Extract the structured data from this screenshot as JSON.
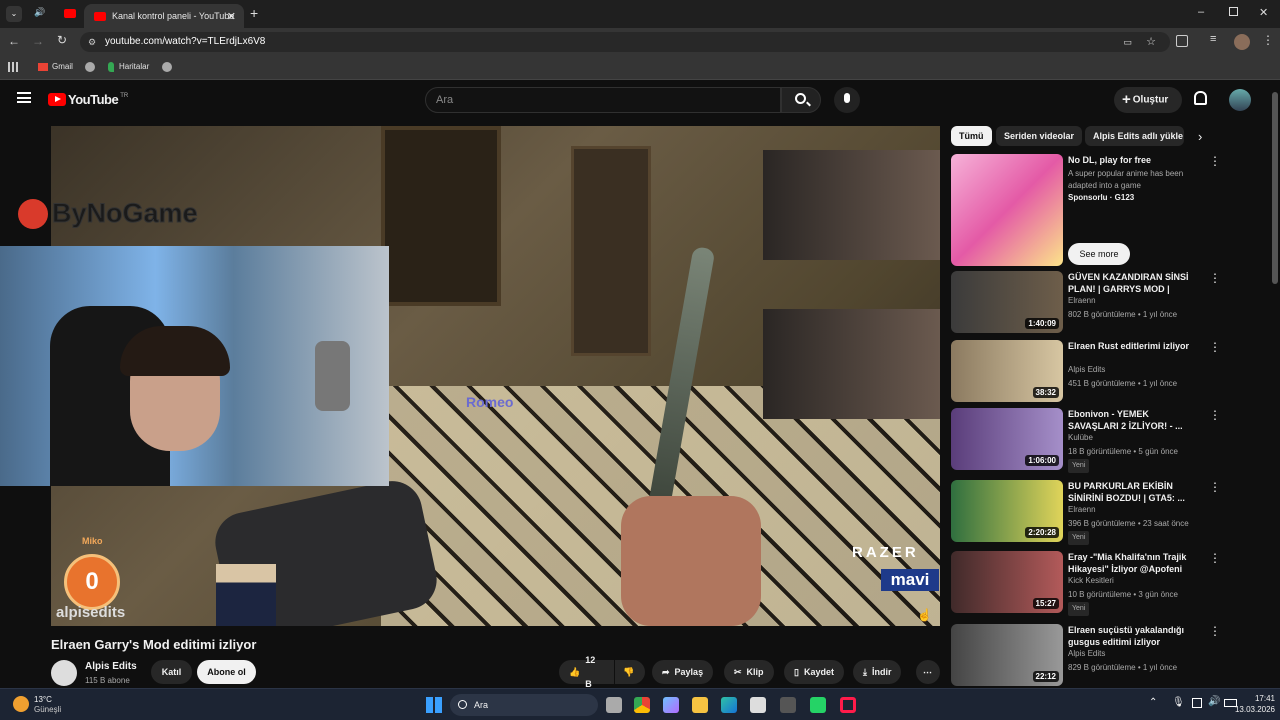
{
  "browser": {
    "tab_title": "Kanal kontrol paneli - YouTube",
    "url": "youtube.com/watch?v=TLErdjLx6V8",
    "bookmarks": [
      "Gmail",
      "Haritalar"
    ]
  },
  "header": {
    "logo": "YouTube",
    "region": "TR",
    "search_placeholder": "Ara",
    "create_label": "Oluştur"
  },
  "video": {
    "overlay_channel": "ByNoGame",
    "counter_label": "Miko",
    "counter_value": "0",
    "watermark": "alpisedits",
    "brand1": "RAZER",
    "brand2": "mavi",
    "nametag": "Romeo"
  },
  "watch": {
    "title": "Elraen Garry's Mod editimi izliyor",
    "channel": "Alpis Edits",
    "subs": "115 B abone",
    "join": "Katıl",
    "subscribe": "Abone ol",
    "likes": "12 B",
    "share": "Paylaş",
    "clip": "Klip",
    "save": "Kaydet",
    "download": "İndir"
  },
  "chips": [
    "Tümü",
    "Seriden videolar",
    "Alpis Edits adlı yükle"
  ],
  "recs": [
    {
      "title": "No DL, play for free",
      "line1": "A super popular anime has been adapted into a game",
      "line2": "Sponsorlu · G123",
      "cta": "See more"
    },
    {
      "title": "GÜVEN KAZANDIRAN SİNSİ PLAN! | GARRYS MOD |",
      "channel": "Elraenn",
      "views": "802 B görüntüleme • 1 yıl önce",
      "duration": "1:40:09"
    },
    {
      "title": "Elraen Rust editlerimi izliyor",
      "channel": "Alpis Edits",
      "views": "451 B görüntüleme • 1 yıl önce",
      "duration": "38:32"
    },
    {
      "title": "Ebonivon - YEMEK SAVAŞLARI 2 İZLİYOR! - ...",
      "channel": "Kulübe",
      "views": "18 B görüntüleme • 5 gün önce",
      "badge": "Yeni",
      "duration": "1:06:00"
    },
    {
      "title": "BU PARKURLAR EKİBİN SİNİRİNİ BOZDU! | GTA5: ...",
      "channel": "Elraenn",
      "views": "396 B görüntüleme • 23 saat önce",
      "badge": "Yeni",
      "duration": "2:20:28"
    },
    {
      "title": "Eray -\"Mia Khalifa'nın Trajik Hikayesi\" İzliyor @Apofeni",
      "channel": "Kick Kesitleri",
      "views": "10 B görüntüleme • 3 gün önce",
      "badge": "Yeni",
      "duration": "15:27"
    },
    {
      "title": "Elraen suçüstü yakalandığı gusgus editimi izliyor",
      "channel": "Alpis Edits",
      "views": "829 B görüntüleme • 1 yıl önce",
      "duration": "22:12"
    }
  ],
  "taskbar": {
    "temp": "13°C",
    "weather": "Güneşli",
    "search": "Ara",
    "time": "17:41",
    "date": "13.03.2026"
  }
}
